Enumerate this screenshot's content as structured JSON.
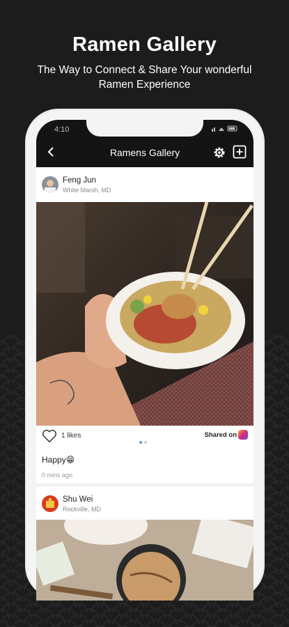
{
  "hero": {
    "title": "Ramen Gallery",
    "subtitle": "The Way to Connect & Share Your wonderful Ramen Experience"
  },
  "status_bar": {
    "time": "4:10",
    "icons": "wifi signal battery"
  },
  "nav": {
    "title": "Ramens Gallery",
    "back_icon": "chevron-left-icon",
    "settings_icon": "gear-icon",
    "add_icon": "add-square-icon"
  },
  "posts": [
    {
      "name": "Feng Jun",
      "location": "White Marsh, MD",
      "likes": "1 likes",
      "shared_label": "Shared on",
      "caption": "Happy😁",
      "time": "0 mins ago"
    },
    {
      "name": "Shu Wei",
      "location": "Rockville, MD"
    }
  ],
  "colors": {
    "dark_bg": "#1c1c1c",
    "bar": "#141414",
    "dot_active": "#4aa3df",
    "dot_inactive": "#cfcfcf"
  }
}
